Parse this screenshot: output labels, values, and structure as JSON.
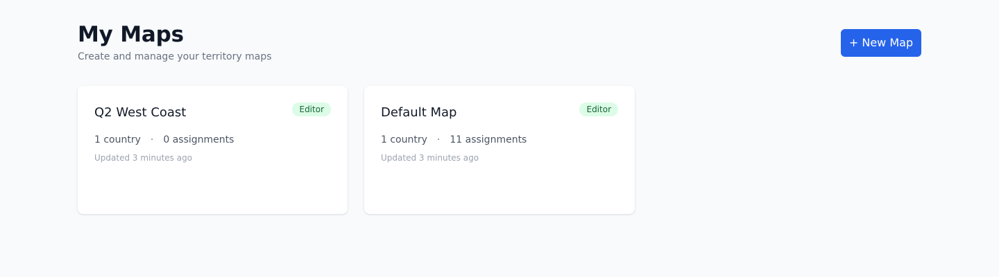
{
  "header": {
    "title": "My Maps",
    "subtitle": "Create and manage your territory maps",
    "new_map_label": "+ New Map"
  },
  "cards": [
    {
      "title": "Q2 West Coast",
      "badge": "Editor",
      "countries": "1 country",
      "separator": "·",
      "assignments": "0 assignments",
      "updated": "Updated 3 minutes ago"
    },
    {
      "title": "Default Map",
      "badge": "Editor",
      "countries": "1 country",
      "separator": "·",
      "assignments": "11 assignments",
      "updated": "Updated 3 minutes ago"
    }
  ],
  "colors": {
    "primary": "#2563eb",
    "badge_bg": "#dcfce7",
    "badge_text": "#166534",
    "page_bg": "#f8fafc"
  }
}
